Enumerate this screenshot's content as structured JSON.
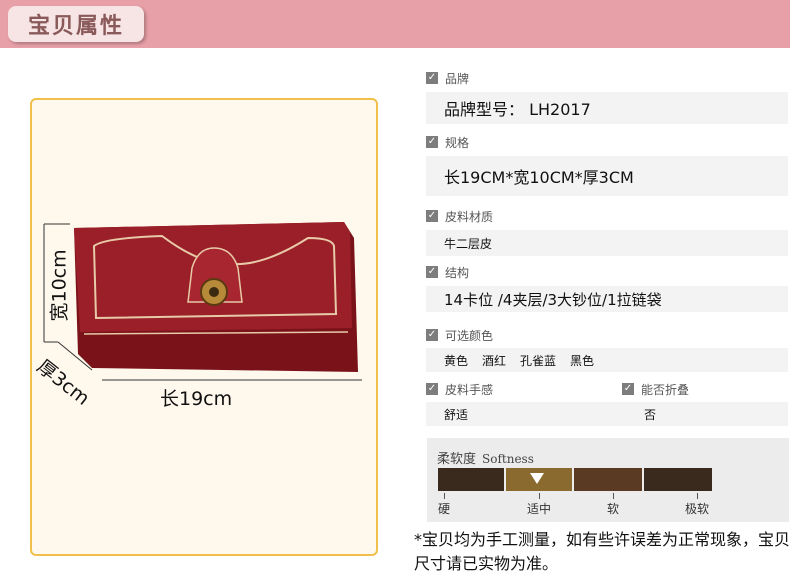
{
  "header": {
    "title": "宝贝属性"
  },
  "dimensions": {
    "width": "长19cm",
    "height": "宽10cm",
    "depth": "厚3cm"
  },
  "specs": {
    "brand": {
      "label": "品牌",
      "value": "品牌型号： LH2017"
    },
    "size": {
      "label": "规格",
      "value": "长19CM*宽10CM*厚3CM"
    },
    "material": {
      "label": "皮料材质",
      "value": "牛二层皮"
    },
    "structure": {
      "label": "结构",
      "value": "14卡位 /4夹层/3大钞位/1拉链袋"
    },
    "colors": {
      "label": "可选颜色",
      "options": [
        "黄色",
        "酒红",
        "孔雀蓝",
        "黑色"
      ]
    },
    "feel": {
      "label": "皮料手感",
      "value": "舒适"
    },
    "foldable": {
      "label": "能否折叠",
      "value": "否"
    }
  },
  "softness": {
    "title": "柔软度",
    "title_en": "Softness",
    "levels": [
      "硬",
      "适中",
      "软",
      "极软"
    ],
    "selected": "适中"
  },
  "note": "*宝贝均为手工测量，如有些许误差为正常现象，宝贝尺寸请已实物为准。",
  "colors": {
    "header": "#e8a0a8",
    "wallet": "#8e1a22",
    "frame": "#f0c04a"
  }
}
